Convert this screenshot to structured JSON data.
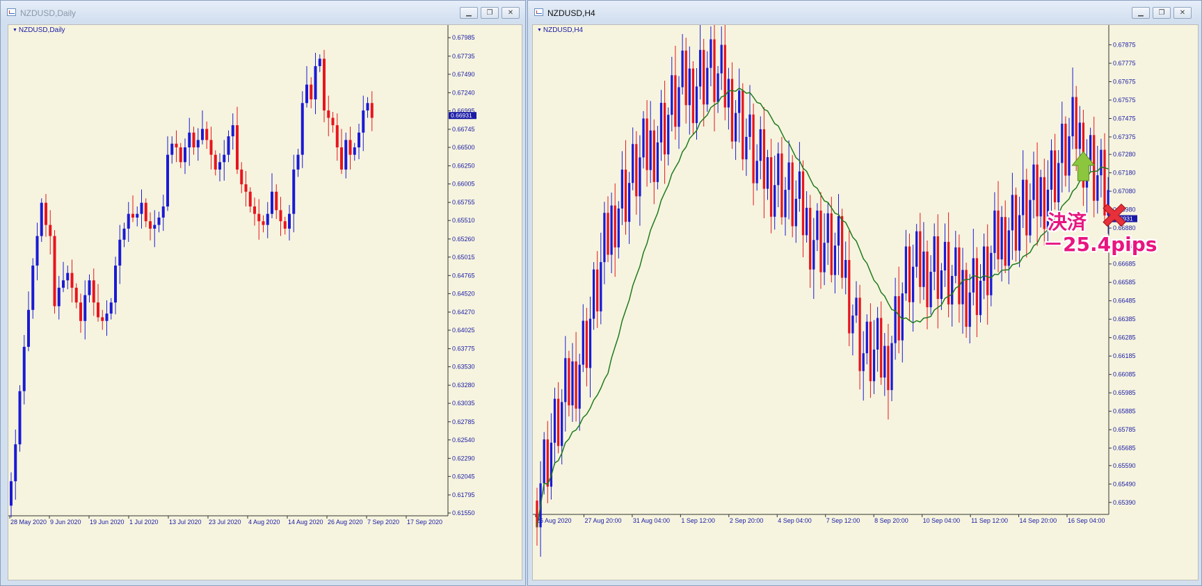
{
  "left_window": {
    "title": "NZDUSD,Daily",
    "chart_label": "NZDUSD,Daily",
    "buttons": {
      "minimize": "▁",
      "restore": "❐",
      "close": "✕"
    }
  },
  "right_window": {
    "title": "NZDUSD,H4",
    "chart_label": "NZDUSD,H4",
    "buttons": {
      "minimize": "▁",
      "restore": "❐",
      "close": "✕"
    }
  },
  "annotation": {
    "line1": "決済",
    "line2": "－25.4pips",
    "long_entry_arrow_color": "#8cc63f",
    "exit_cross_color": "#e8303a"
  },
  "colors": {
    "background": "#f6f4de",
    "bull_candle": "#1a1ad6",
    "bear_candle": "#e8141e",
    "axis_text": "#1a1aa6",
    "moving_average": "#1f7a1f"
  },
  "chart_data": [
    {
      "type": "candlestick",
      "symbol": "NZDUSD",
      "timeframe": "Daily",
      "ylim": [
        0.6155,
        0.681
      ],
      "y_ticks": [
        "0.67985",
        "0.67735",
        "0.67490",
        "0.67240",
        "0.66995",
        "0.66745",
        "0.66500",
        "0.66250",
        "0.66005",
        "0.65755",
        "0.65510",
        "0.65260",
        "0.65015",
        "0.64765",
        "0.64520",
        "0.64270",
        "0.64025",
        "0.63775",
        "0.63530",
        "0.63280",
        "0.63035",
        "0.62785",
        "0.62540",
        "0.62290",
        "0.62045",
        "0.61795",
        "0.61550"
      ],
      "y_tick_values": [
        0.67985,
        0.67735,
        0.6749,
        0.6724,
        0.66995,
        0.66745,
        0.665,
        0.6625,
        0.66005,
        0.65755,
        0.6551,
        0.6526,
        0.65015,
        0.64765,
        0.6452,
        0.6427,
        0.64025,
        0.63775,
        0.6353,
        0.6328,
        0.63035,
        0.62785,
        0.6254,
        0.6229,
        0.62045,
        0.61795,
        0.6155
      ],
      "current_price": "0.66931",
      "x_ticks": [
        "28 May 2020",
        "9 Jun 2020",
        "19 Jun 2020",
        "1 Jul 2020",
        "13 Jul 2020",
        "23 Jul 2020",
        "4 Aug 2020",
        "14 Aug 2020",
        "26 Aug 2020",
        "7 Sep 2020",
        "17 Sep 2020"
      ],
      "closes": [
        0.6198,
        0.6248,
        0.632,
        0.638,
        0.643,
        0.649,
        0.653,
        0.6575,
        0.6545,
        0.653,
        0.6435,
        0.646,
        0.647,
        0.648,
        0.646,
        0.644,
        0.6415,
        0.645,
        0.647,
        0.644,
        0.642,
        0.6415,
        0.6425,
        0.644,
        0.649,
        0.6525,
        0.654,
        0.656,
        0.6555,
        0.656,
        0.6575,
        0.655,
        0.654,
        0.6545,
        0.6555,
        0.657,
        0.664,
        0.6655,
        0.665,
        0.663,
        0.665,
        0.667,
        0.665,
        0.666,
        0.6675,
        0.666,
        0.664,
        0.662,
        0.663,
        0.664,
        0.6665,
        0.668,
        0.662,
        0.66,
        0.659,
        0.657,
        0.656,
        0.655,
        0.6545,
        0.656,
        0.659,
        0.6565,
        0.655,
        0.654,
        0.656,
        0.662,
        0.664,
        0.671,
        0.6735,
        0.6715,
        0.676,
        0.677,
        0.67,
        0.669,
        0.668,
        0.665,
        0.662,
        0.666,
        0.664,
        0.665,
        0.667,
        0.67,
        0.671,
        0.669
      ],
      "wick_range": [
        0.616,
        0.679
      ],
      "indicators": []
    },
    {
      "type": "candlestick",
      "symbol": "NZDUSD",
      "timeframe": "H4",
      "ylim": [
        0.6534,
        0.6796
      ],
      "y_ticks": [
        "0.67875",
        "0.67775",
        "0.67675",
        "0.67575",
        "0.67475",
        "0.67375",
        "0.67280",
        "0.67180",
        "0.67080",
        "0.66980",
        "0.66880",
        "0.66780",
        "0.66685",
        "0.66585",
        "0.66485",
        "0.66385",
        "0.66285",
        "0.66185",
        "0.66085",
        "0.65985",
        "0.65885",
        "0.65785",
        "0.65685",
        "0.65590",
        "0.65490",
        "0.65390"
      ],
      "y_tick_values": [
        0.67875,
        0.67775,
        0.67675,
        0.67575,
        0.67475,
        0.67375,
        0.6728,
        0.6718,
        0.6708,
        0.6698,
        0.6688,
        0.6678,
        0.66685,
        0.66585,
        0.66485,
        0.66385,
        0.66285,
        0.66185,
        0.66085,
        0.65985,
        0.65885,
        0.65785,
        0.65685,
        0.6559,
        0.6549,
        0.6539
      ],
      "current_price": "0.66931",
      "x_ticks": [
        "26 Aug 2020",
        "27 Aug 20:00",
        "31 Aug 04:00",
        "1 Sep 12:00",
        "2 Sep 20:00",
        "4 Sep 04:00",
        "7 Sep 12:00",
        "8 Sep 20:00",
        "10 Sep 04:00",
        "11 Sep 12:00",
        "14 Sep 20:00",
        "16 Sep 04:00"
      ],
      "indicators": [
        {
          "type": "moving_average",
          "color": "#1f7a1f"
        }
      ],
      "markers": [
        {
          "type": "buy_arrow",
          "near_price": 0.6722
        },
        {
          "type": "exit_cross",
          "near_price": 0.67
        }
      ]
    }
  ]
}
